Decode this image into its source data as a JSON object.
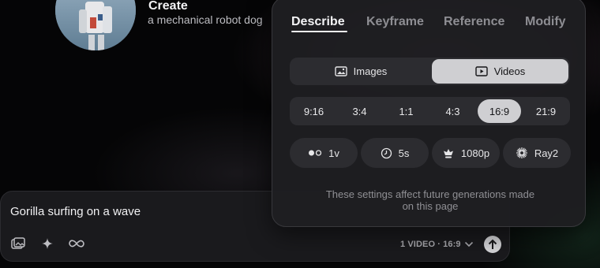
{
  "header": {
    "title": "Create",
    "subtitle": "a mechanical robot dog"
  },
  "prompt": {
    "text": "Gorilla surfing on a wave",
    "summary": "1 VIDEO · 16:9",
    "icons": [
      "image-upload-icon",
      "sparkle-icon",
      "infinity-icon",
      "chevron-down-icon",
      "arrow-up-icon"
    ]
  },
  "panel": {
    "tabs": [
      {
        "label": "Describe",
        "active": true
      },
      {
        "label": "Keyframe",
        "active": false
      },
      {
        "label": "Reference",
        "active": false
      },
      {
        "label": "Modify",
        "active": false
      }
    ],
    "media": [
      {
        "label": "Images",
        "icon": "image-icon",
        "active": false
      },
      {
        "label": "Videos",
        "icon": "video-icon",
        "active": true
      }
    ],
    "ratios": [
      "9:16",
      "3:4",
      "1:1",
      "4:3",
      "16:9",
      "21:9"
    ],
    "selected_ratio": "16:9",
    "options": [
      {
        "label": "1v",
        "icon": "count-dots-icon"
      },
      {
        "label": "5s",
        "icon": "clock-icon"
      },
      {
        "label": "1080p",
        "icon": "quality-icon"
      },
      {
        "label": "Ray2",
        "icon": "ray-icon"
      }
    ],
    "note": "These settings affect future generations made on this page"
  },
  "colors": {
    "panel_bg": "#1e1e21",
    "active_pill": "#cfcfd2",
    "muted_text": "#8f8f94"
  }
}
